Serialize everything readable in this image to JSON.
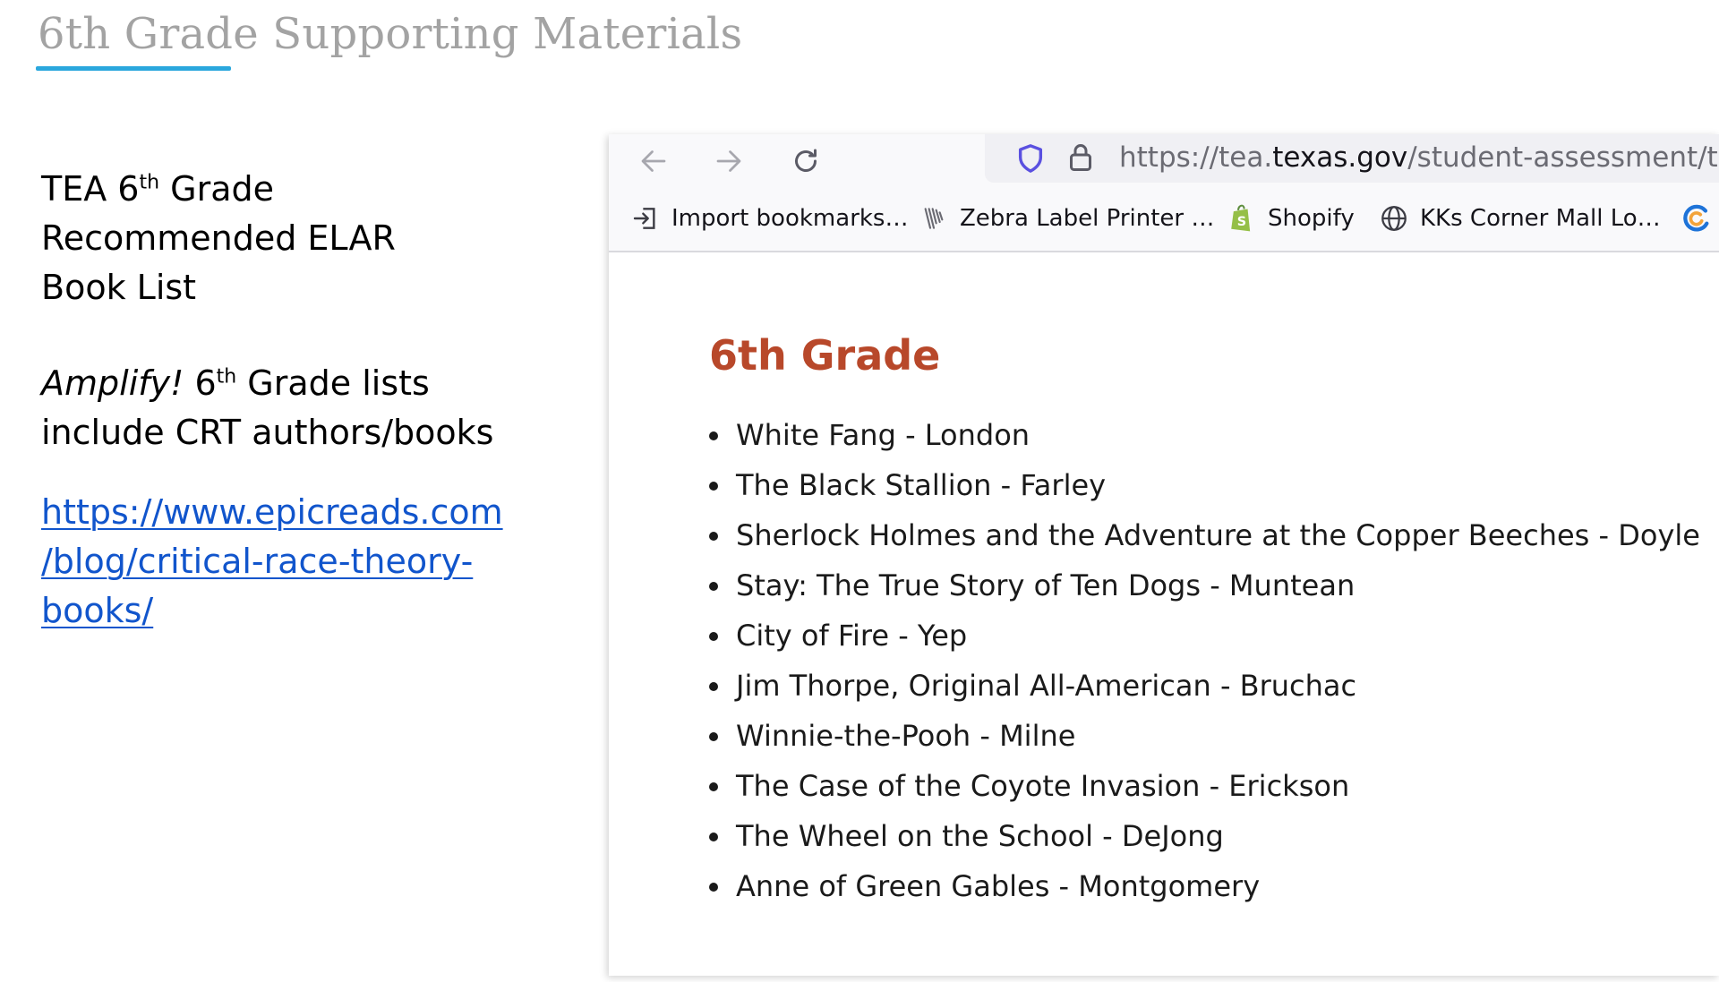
{
  "slide": {
    "title": "6th Grade Supporting Materials",
    "tea_line1_prefix": "TEA 6",
    "tea_line1_sup": "th",
    "tea_line1_suffix": " Grade",
    "tea_line2": "Recommended ELAR",
    "tea_line3": "Book List",
    "amplify_italic": "Amplify!",
    "amplify_prefix": " 6",
    "amplify_sup": "th",
    "amplify_suffix": " Grade lists",
    "amplify_line2": "include CRT authors/books",
    "link_line1": "https://www.epicreads.com",
    "link_line2": "/blog/critical-race-theory-",
    "link_line3": "books/",
    "accent_color": "#2aa7dd",
    "link_color": "#1155cc"
  },
  "browser": {
    "url_prefix": "https://tea.",
    "url_host": "texas.gov",
    "url_path": "/student-assessment/tes",
    "bookmarks": [
      {
        "label": "Import bookmarks…",
        "icon": "import-icon"
      },
      {
        "label": "Zebra Label Printer …",
        "icon": "zebra-icon"
      },
      {
        "label": "Shopify",
        "icon": "shopify-icon"
      },
      {
        "label": "KKs Corner Mall Lo…",
        "icon": "globe-icon"
      }
    ]
  },
  "page": {
    "heading": "6th Grade",
    "heading_color": "#b8482a",
    "books": [
      "White Fang - London",
      "The Black Stallion - Farley",
      "Sherlock Holmes and the Adventure at the Copper Beeches - Doyle",
      "Stay: The True Story of Ten Dogs - Muntean",
      "City of Fire - Yep",
      "Jim Thorpe, Original All-American - Bruchac",
      "Winnie-the-Pooh - Milne",
      "The Case of the Coyote Invasion - Erickson",
      "The Wheel on the School - DeJong",
      "Anne of Green Gables - Montgomery"
    ]
  }
}
